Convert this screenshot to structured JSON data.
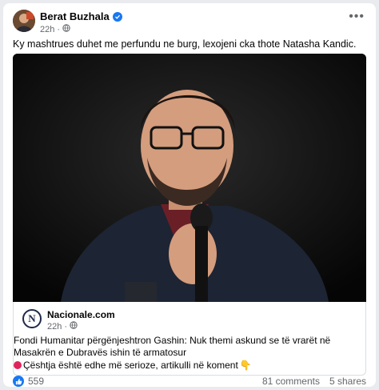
{
  "post": {
    "author": "Berat Buzhala",
    "time": "22h",
    "caption": "Ky mashtrues duhet me perfundu ne burg, lexojeni cka thote Natasha Kandic."
  },
  "link": {
    "source_logo": "N",
    "source": "Nacionale.com",
    "time": "22h",
    "headline": "Fondi Humanitar përgënjeshtron Gashin: Nuk themi askund se të vrarët në Masakrën e Dubravës ishin të armatosur",
    "subline": "Çështja është edhe më serioze, artikulli në koment",
    "subline_emoji": "👇"
  },
  "footer": {
    "reactions": "559",
    "comments": "81 comments",
    "shares": "5 shares"
  },
  "icons": {
    "verified": "verified-badge-icon",
    "privacy": "globe-icon",
    "more": "more-options-icon",
    "like": "like-icon"
  },
  "colors": {
    "accent": "#1877f2",
    "text": "#050505",
    "muted": "#65676b"
  }
}
